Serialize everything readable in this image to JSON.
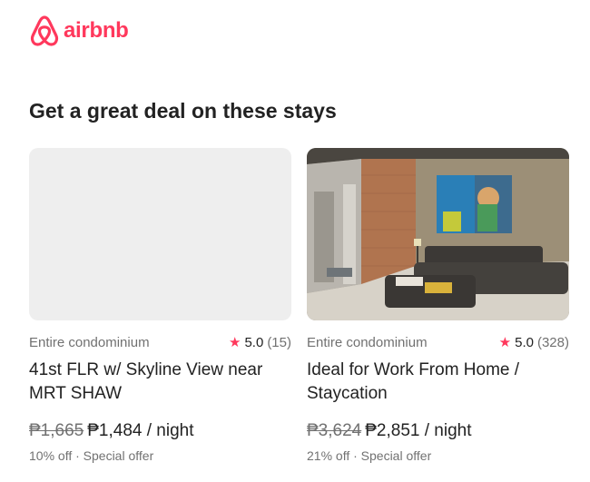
{
  "brand": {
    "name": "airbnb",
    "color": "#FF385C",
    "icon": "airbnb-belo-icon"
  },
  "section": {
    "title": "Get a great deal on these stays"
  },
  "listings": [
    {
      "type": "Entire condominium",
      "star_icon": "star-icon",
      "rating": "5.0",
      "reviews": "(15)",
      "name": "41st FLR w/ Skyline View near MRT SHAW",
      "original_price": "₱1,665",
      "price": "₱1,484",
      "price_unit": "/ night",
      "discount": "10% off · Special offer"
    },
    {
      "type": "Entire condominium",
      "star_icon": "star-icon",
      "rating": "5.0",
      "reviews": "(328)",
      "name": "Ideal for Work From Home / Staycation",
      "original_price": "₱3,624",
      "price": "₱2,851",
      "price_unit": "/ night",
      "discount": "21% off · Special offer"
    }
  ]
}
